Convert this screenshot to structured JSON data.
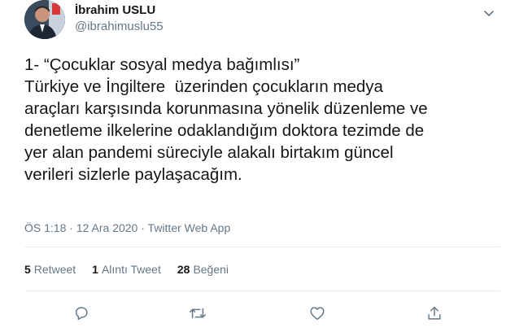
{
  "author": {
    "name": "İbrahim USLU",
    "handle": "@ibrahimuslu55"
  },
  "tweet": {
    "lines": [
      "1- “Çocuklar sosyal medya bağımlısı”",
      "Türkiye ve İngiltere  üzerinden çocukların medya",
      "araçları karşısında korunmasına yönelik düzenleme ve",
      "denetleme ilkelerine odaklandığım doktora tezimde de",
      "yer alan pandemi süreciyle alakalı birtakım güncel",
      "verileri sizlerle paylaşacağım."
    ],
    "time": "ÖS 1:18",
    "separator": " · ",
    "date": "12 Ara 2020",
    "source": "Twitter Web App"
  },
  "stats": {
    "retweets_count": "5",
    "retweets_label": "Retweet",
    "quotes_count": "1",
    "quotes_label": "Alıntı Tweet",
    "likes_count": "28",
    "likes_label": "Beğeni"
  },
  "actions": [
    {
      "name": "reply-button",
      "icon": "comment-icon"
    },
    {
      "name": "retweet-button",
      "icon": "retweet-icon"
    },
    {
      "name": "like-button",
      "icon": "heart-icon"
    },
    {
      "name": "share-button",
      "icon": "share-icon"
    }
  ],
  "colors": {
    "text": "#14171a",
    "muted": "#657786",
    "divider": "#e6ecf0"
  }
}
